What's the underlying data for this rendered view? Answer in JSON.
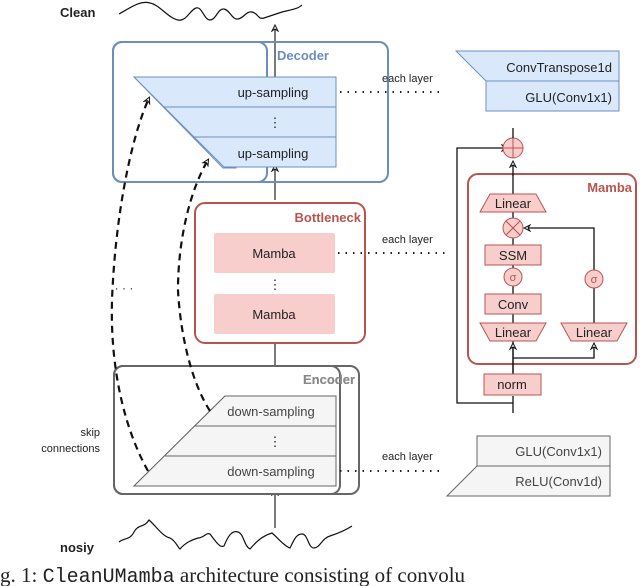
{
  "signals": {
    "clean_label": "Clean",
    "noisy_label": "nosiy"
  },
  "decoder": {
    "title": "Decoder",
    "layer_top": "up-sampling",
    "ellipsis": "⋮",
    "layer_bottom": "up-sampling",
    "each_layer_label": "each layer",
    "detail": [
      "ConvTranspose1d",
      "GLU(Conv1x1)"
    ]
  },
  "bottleneck": {
    "title": "Bottleneck",
    "block_top": "Mamba",
    "ellipsis": "⋮",
    "block_bottom": "Mamba",
    "each_layer_label": "each layer"
  },
  "encoder": {
    "title": "Encoder",
    "layer_top": "down-sampling",
    "ellipsis": "⋮",
    "layer_bottom": "down-sampling",
    "each_layer_label": "each layer",
    "detail": [
      "GLU(Conv1x1)",
      "ReLU(Conv1d)"
    ]
  },
  "skip": {
    "label_line1": "skip",
    "label_line2": "connections",
    "ellipsis": "· · ·"
  },
  "mamba": {
    "title": "Mamba",
    "out_linear": "Linear",
    "multiply_symbol": "⊗",
    "ssm": "SSM",
    "sigma_left": "σ",
    "conv": "Conv",
    "in_linear_left": "Linear",
    "sigma_right": "σ",
    "in_linear_right": "Linear",
    "norm": "norm",
    "add_symbol": "⊕"
  },
  "caption": {
    "prefix": "g. 1: ",
    "name": "CleanUMamba",
    "rest": " architecture consisting of convolu"
  },
  "colors": {
    "decoder_stroke": "#6c8ebf",
    "decoder_fill": "#dae8fc",
    "mamba_stroke": "#b85450",
    "mamba_fill": "#f8cecc",
    "encoder_stroke": "#666666",
    "encoder_fill": "#f5f5f5"
  }
}
